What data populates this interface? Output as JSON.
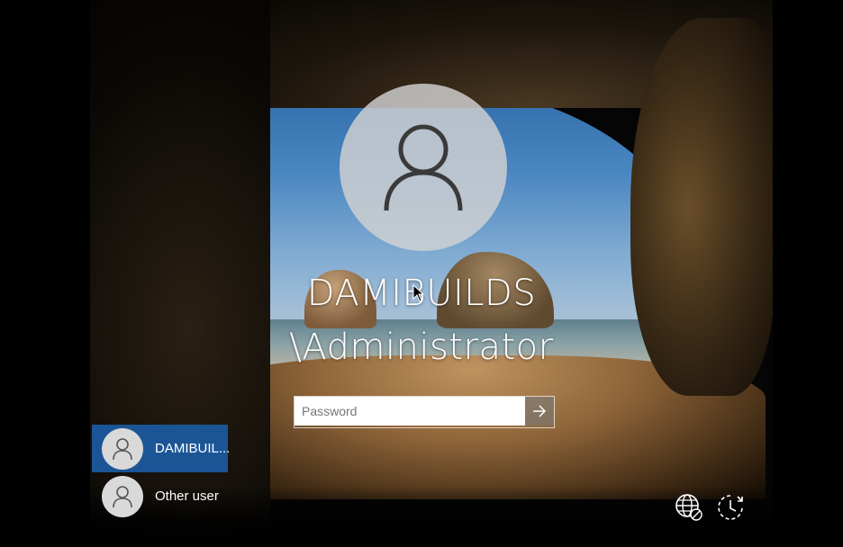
{
  "account": {
    "line1": "DAMIBUILDS",
    "line2": "\\Administrator"
  },
  "password": {
    "placeholder": "Password",
    "submit_icon": "arrow-right-icon"
  },
  "user_list": [
    {
      "label": "DAMIBUIL...",
      "selected": true,
      "icon": "user-icon"
    },
    {
      "label": "Other user",
      "selected": false,
      "icon": "user-icon"
    }
  ],
  "system_icons": [
    {
      "name": "network-icon"
    },
    {
      "name": "ease-of-access-icon"
    }
  ],
  "colors": {
    "selected_user_bg": "#1b5596",
    "avatar_bg": "#d2d2d2"
  }
}
